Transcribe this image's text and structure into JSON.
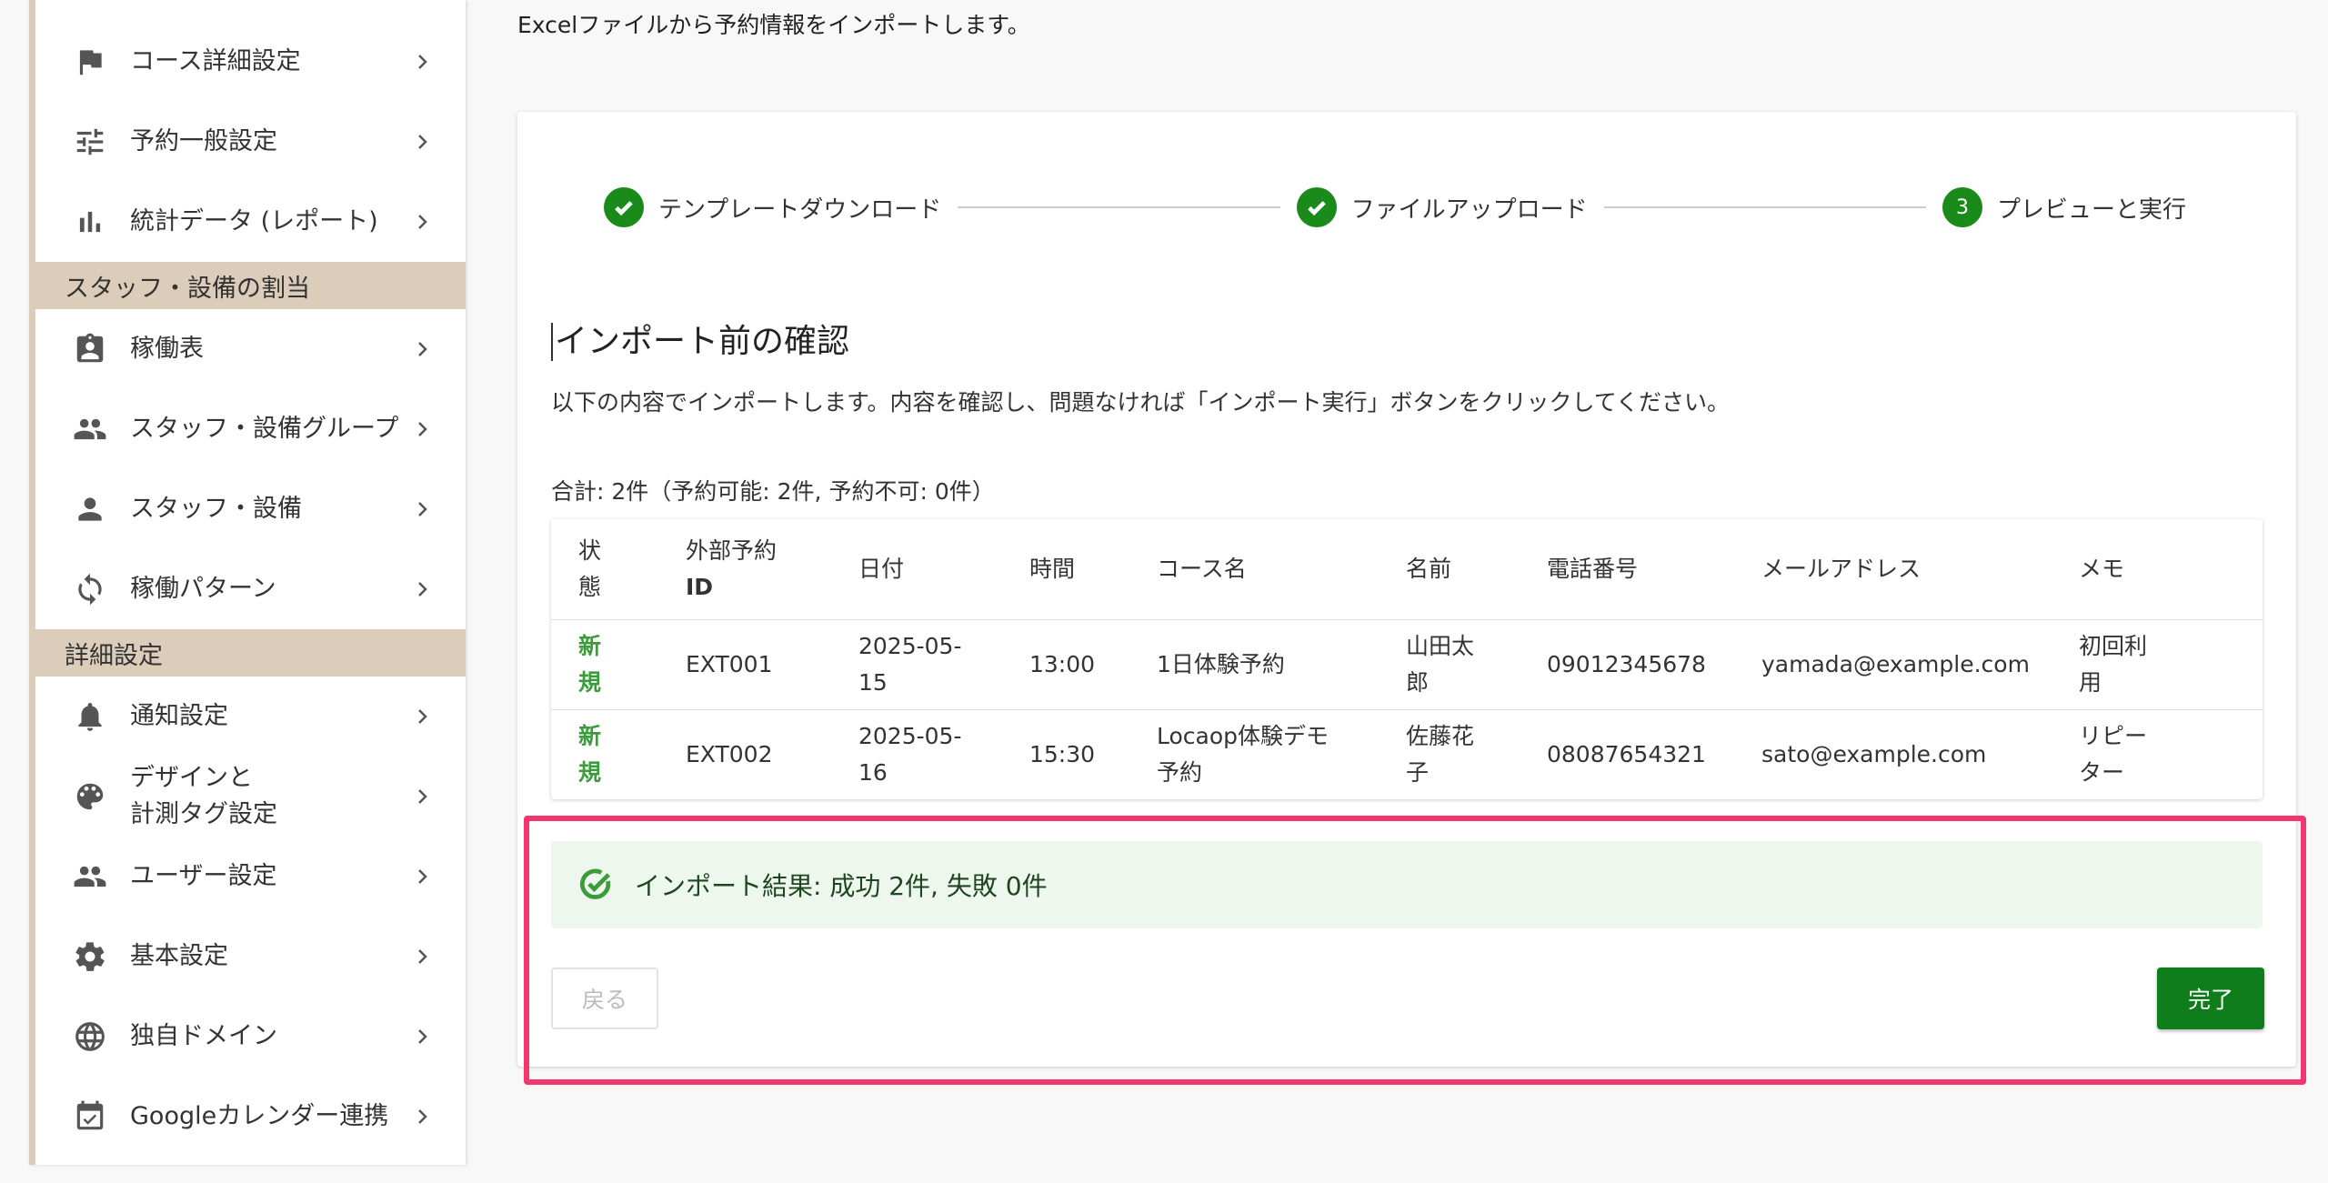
{
  "sidebar": {
    "items_top": [
      {
        "label": "コース詳細設定",
        "icon": "flag-icon"
      },
      {
        "label": "予約一般設定",
        "icon": "tune-icon"
      },
      {
        "label": "統計データ (レポート)",
        "icon": "bar-chart-icon"
      }
    ],
    "section1": "スタッフ・設備の割当",
    "items_mid": [
      {
        "label": "稼働表",
        "icon": "assignment-ind-icon"
      },
      {
        "label": "スタッフ・設備グループ",
        "icon": "people-icon"
      },
      {
        "label": "スタッフ・設備",
        "icon": "person-icon"
      },
      {
        "label": "稼働パターン",
        "icon": "sync-icon"
      }
    ],
    "section2": "詳細設定",
    "items_bottom": [
      {
        "label": "通知設定",
        "icon": "bell-icon"
      },
      {
        "label_line1": "デザインと",
        "label_line2": "計測タグ設定",
        "icon": "palette-icon"
      },
      {
        "label": "ユーザー設定",
        "icon": "people-icon"
      },
      {
        "label": "基本設定",
        "icon": "gear-icon"
      },
      {
        "label": "独自ドメイン",
        "icon": "globe-icon"
      },
      {
        "label": "Googleカレンダー連携",
        "icon": "calendar-check-icon"
      }
    ]
  },
  "main": {
    "intro": "Excelファイルから予約情報をインポートします。",
    "steps": [
      {
        "label": "テンプレートダウンロード",
        "state": "done"
      },
      {
        "label": "ファイルアップロード",
        "state": "done"
      },
      {
        "label": "プレビューと実行",
        "number": "3",
        "state": "active"
      }
    ],
    "confirm_title": "インポート前の確認",
    "confirm_desc": "以下の内容でインポートします。内容を確認し、問題なければ「インポート実行」ボタンをクリックしてください。",
    "summary": "合計: 2件（予約可能: 2件, 予約不可: 0件）",
    "table": {
      "headers": {
        "status1": "状",
        "status2": "態",
        "extid1": "外部予約",
        "extid2": "ID",
        "date": "日付",
        "time": "時間",
        "course": "コース名",
        "name": "名前",
        "phone": "電話番号",
        "email": "メールアドレス",
        "memo": "メモ"
      },
      "rows": [
        {
          "status1": "新",
          "status2": "規",
          "extid": "EXT001",
          "date1": "2025-05-",
          "date2": "15",
          "time": "13:00",
          "course1": "1日体験予約",
          "course2": "",
          "name1": "山田太",
          "name2": "郎",
          "phone": "09012345678",
          "email": "yamada@example.com",
          "memo1": "初回利",
          "memo2": "用"
        },
        {
          "status1": "新",
          "status2": "規",
          "extid": "EXT002",
          "date1": "2025-05-",
          "date2": "16",
          "time": "15:30",
          "course1": "Locaop体験デモ",
          "course2": "予約",
          "name1": "佐藤花",
          "name2": "子",
          "phone": "08087654321",
          "email": "sato@example.com",
          "memo1": "リピー",
          "memo2": "ター"
        }
      ]
    },
    "result": "インポート結果: 成功 2件, 失敗 0件",
    "back_label": "戻る",
    "done_label": "完了"
  },
  "colors": {
    "accent_green": "#0f7d1c",
    "sidebar_tan": "#dccdbb",
    "highlight": "#f2366f",
    "success_bg": "#edf7ed"
  }
}
